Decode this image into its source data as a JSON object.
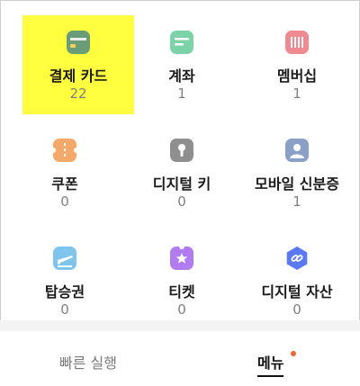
{
  "tiles": [
    {
      "label": "결제 카드",
      "count": "22",
      "icon": "card-icon",
      "color": "#6a9c78"
    },
    {
      "label": "계좌",
      "count": "1",
      "icon": "account-icon",
      "color": "#7dd3a8"
    },
    {
      "label": "멤버십",
      "count": "1",
      "icon": "membership-icon",
      "color": "#ef8a92"
    },
    {
      "label": "쿠폰",
      "count": "0",
      "icon": "coupon-icon",
      "color": "#f4a86a"
    },
    {
      "label": "디지털 키",
      "count": "0",
      "icon": "key-icon",
      "color": "#8f8f8f"
    },
    {
      "label": "모바일 신분증",
      "count": "1",
      "icon": "id-card-icon",
      "color": "#8aa0c6"
    },
    {
      "label": "탑승권",
      "count": "0",
      "icon": "boarding-pass-icon",
      "color": "#7ec4ec"
    },
    {
      "label": "티켓",
      "count": "0",
      "icon": "ticket-icon",
      "color": "#b17cf0"
    },
    {
      "label": "디지털 자산",
      "count": "0",
      "icon": "digital-asset-icon",
      "color": "#5b78f5"
    }
  ],
  "tabbar": {
    "quick_label": "빠른 실행",
    "menu_label": "메뉴",
    "badge_color": "#e8663a"
  },
  "highlight_color": "#ffff40"
}
